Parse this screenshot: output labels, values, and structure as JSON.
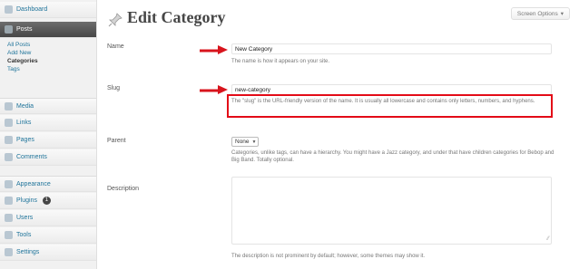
{
  "sidebar": {
    "dashboard": "Dashboard",
    "posts": "Posts",
    "posts_sub": [
      "All Posts",
      "Add New",
      "Categories",
      "Tags"
    ],
    "media": "Media",
    "links": "Links",
    "pages": "Pages",
    "comments": "Comments",
    "appearance": "Appearance",
    "plugins": "Plugins",
    "plugins_badge": "1",
    "users": "Users",
    "tools": "Tools",
    "settings": "Settings"
  },
  "header": {
    "title": "Edit Category",
    "screen_options": "Screen Options"
  },
  "form": {
    "name_label": "Name",
    "name_value": "New Category",
    "name_help": "The name is how it appears on your site.",
    "slug_label": "Slug",
    "slug_value": "new-category",
    "slug_help": "The \"slug\" is the URL-friendly version of the name. It is usually all lowercase and contains only letters, numbers, and hyphens.",
    "parent_label": "Parent",
    "parent_value": "None",
    "parent_help": "Categories, unlike tags, can have a hierarchy. You might have a Jazz category, and under that have children categories for Bebop and Big Band. Totally optional.",
    "description_label": "Description",
    "description_value": "",
    "description_help": "The description is not prominent by default; however, some themes may show it."
  },
  "colors": {
    "accent": "#21759b",
    "highlight": "#e30b17",
    "arrow": "#d8141d"
  }
}
